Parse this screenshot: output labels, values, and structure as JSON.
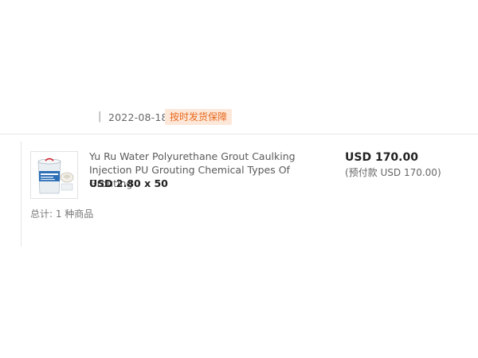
{
  "order": {
    "separator": "|",
    "date": "2022-08-18",
    "badge": "按时发货保障"
  },
  "product": {
    "image_alt": "polyurethane-grout-product-image",
    "title": "Yu Ru Water Polyurethane Grout Caulking Injection PU Grouting Chemical Types Of Grouting",
    "unit_price": "USD 2.80 x 50",
    "total": "USD 170.00",
    "prepay": "(预付款 USD 170.00)"
  },
  "summary": {
    "count_text": "总计: 1 种商品"
  },
  "colors": {
    "badge_text": "#e86a1f",
    "badge_bg": "#fde7d8"
  }
}
